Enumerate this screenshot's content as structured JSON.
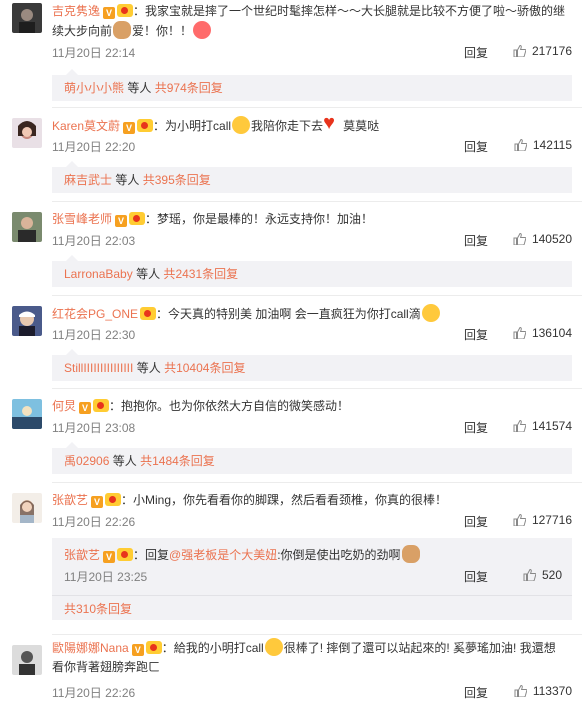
{
  "labels": {
    "reply": "回复",
    "people_suffix": "等人",
    "total_prefix": "共",
    "reply_suffix": "条回复"
  },
  "comments": [
    {
      "user": "吉克隽逸",
      "text1": "：我家宝就是摔了一个世纪时髦摔怎样～～大长腿就是比较不方便了啦～骄傲的继",
      "text2": "续大步向前",
      "text3": "爱！你！！",
      "time": "11月20日 22:14",
      "likes": "217176",
      "sub_user": "萌小小小熊",
      "sub_count": "974"
    },
    {
      "user": "Karen莫文蔚",
      "text1": "：为小明打call",
      "text2": "我陪你走下去",
      "text3": "莫莫哒",
      "time": "11月20日 22:20",
      "likes": "142115",
      "sub_user": "麻吉武士",
      "sub_count": "395"
    },
    {
      "user": "张雪峰老师",
      "text1": "：梦瑶，你是最棒的！永远支持你！加油！",
      "time": "11月20日 22:03",
      "likes": "140520",
      "sub_user": "LarronaBaby",
      "sub_count": "2431"
    },
    {
      "user": "红花会PG_ONE",
      "text1": "：今天真的特别美 加油啊 会一直疯狂为你打call滴",
      "time": "11月20日 22:30",
      "likes": "136104",
      "sub_user": "StillIIIIIIIIIIIIIII",
      "sub_count": "10404"
    },
    {
      "user": "何炅",
      "text1": "：抱抱你。也为你依然大方自信的微笑感动！",
      "time": "11月20日 23:08",
      "likes": "141574",
      "sub_user": "禹02906",
      "sub_count": "1484"
    },
    {
      "user": "张歆艺",
      "text1": "：小Ming，你先看看你的脚踝，然后看看颈椎，你真的很棒！",
      "time": "11月20日 22:26",
      "likes": "127716",
      "nested": {
        "user": "张歆艺",
        "text1": "：回复",
        "mention": "@强老板是个大美妞",
        "text2": ":你倒是使出吃奶的劲啊",
        "time": "11月20日 23:25",
        "likes": "520"
      },
      "more": "共310条回复"
    },
    {
      "user": "歐陽娜娜Nana",
      "text1": "：給我的小明打call",
      "text2": "很棒了! 摔倒了還可以站起來的! 奚夢瑤加油! 我還想",
      "text3": "看你背著翅膀奔跑ㄈ",
      "time": "11月20日 22:26",
      "likes": "113370"
    }
  ]
}
